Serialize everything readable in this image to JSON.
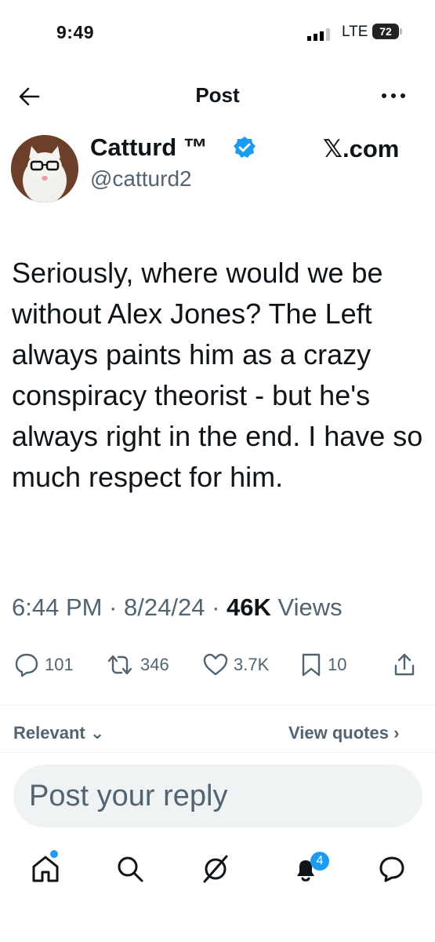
{
  "status_bar": {
    "time": "9:49",
    "network": "LTE",
    "battery": "72"
  },
  "header": {
    "title": "Post"
  },
  "author": {
    "name": "Catturd ™",
    "handle": "@catturd2",
    "source": "𝕏.com"
  },
  "tweet": {
    "text": "Seriously, where would we be without Alex Jones?  The Left always paints him as a crazy conspiracy theorist - but he's always right in the end. I have so much respect for him.",
    "time": "6:44 PM",
    "date": "8/24/24",
    "views_count": "46K",
    "views_label": "Views"
  },
  "actions": {
    "replies": "101",
    "reposts": "346",
    "likes": "3.7K",
    "bookmarks": "10"
  },
  "filters": {
    "sort": "Relevant",
    "view_quotes": "View quotes"
  },
  "reply": {
    "placeholder": "Post your reply"
  },
  "nav": {
    "notifications_badge": "4"
  },
  "colors": {
    "accent": "#1d9bf0",
    "text": "#0f1419",
    "muted": "#536471"
  }
}
